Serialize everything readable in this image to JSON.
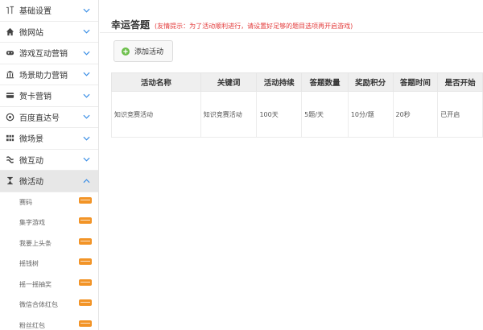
{
  "sidebar": {
    "items": [
      {
        "label": "基础设置",
        "icon": "tools-icon",
        "expanded": false
      },
      {
        "label": "微网站",
        "icon": "home-icon",
        "expanded": false
      },
      {
        "label": "游戏互动营销",
        "icon": "gamepad-icon",
        "expanded": false
      },
      {
        "label": "场景助力营销",
        "icon": "bank-icon",
        "expanded": false
      },
      {
        "label": "贺卡营销",
        "icon": "card-icon",
        "expanded": false
      },
      {
        "label": "百度直达号",
        "icon": "baidu-icon",
        "expanded": false
      },
      {
        "label": "微场景",
        "icon": "grid-icon",
        "expanded": false
      },
      {
        "label": "微互动",
        "icon": "interact-icon",
        "expanded": false
      },
      {
        "label": "微活动",
        "icon": "hourglass-icon",
        "expanded": true
      }
    ],
    "sub_items": [
      {
        "label": "赛码"
      },
      {
        "label": "集字游戏"
      },
      {
        "label": "我要上头条"
      },
      {
        "label": "摇钱树"
      },
      {
        "label": "摇一摇抽奖"
      },
      {
        "label": "微信合体红包"
      },
      {
        "label": "粉丝红包"
      }
    ],
    "badge_color": "#f29427"
  },
  "main": {
    "title": "幸运答题",
    "tip": "(友情提示：为了活动顺利进行，请设置好足够的题目选项再开启游戏)",
    "add_button": "添加活动",
    "add_icon_color": "#6cbf4a",
    "table": {
      "headers": [
        "活动名称",
        "关键词",
        "活动持续",
        "答题数量",
        "奖励积分",
        "答题时间",
        "是否开始"
      ],
      "rows": [
        [
          "知识竞赛活动",
          "知识竞赛活动",
          "100天",
          "5题/天",
          "10分/题",
          "20秒",
          "已开启"
        ]
      ]
    }
  }
}
